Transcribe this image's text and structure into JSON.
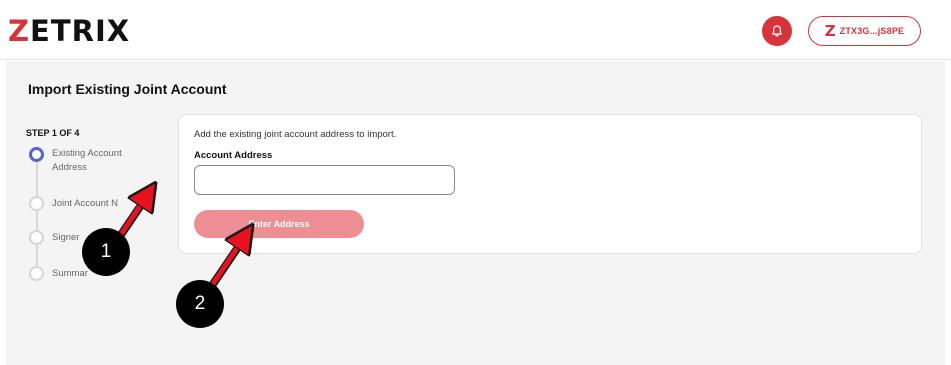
{
  "header": {
    "logo_initial": "Z",
    "logo_rest": "ETRIX",
    "notification_icon": "bell-icon",
    "wallet": {
      "icon": "Z",
      "address": "ZTX3G...jS8PE"
    }
  },
  "page": {
    "title": "Import Existing Joint Account"
  },
  "stepper": {
    "label": "STEP 1 OF 4",
    "steps": [
      {
        "label": "Existing Account Address",
        "active": true
      },
      {
        "label": "Joint Account N",
        "active": false
      },
      {
        "label": "Signer",
        "active": false
      },
      {
        "label": "Summar",
        "active": false
      }
    ]
  },
  "form": {
    "description": "Add the existing joint account address to import.",
    "field_label": "Account Address",
    "field_value": "",
    "placeholder": "",
    "button_label": "Enter Address"
  },
  "annotations": [
    {
      "number": "1"
    },
    {
      "number": "2"
    }
  ],
  "colors": {
    "brand": "#d6333a",
    "active_step": "#5363d6",
    "button": "#ec8e93",
    "arrow": "#e8121e"
  }
}
